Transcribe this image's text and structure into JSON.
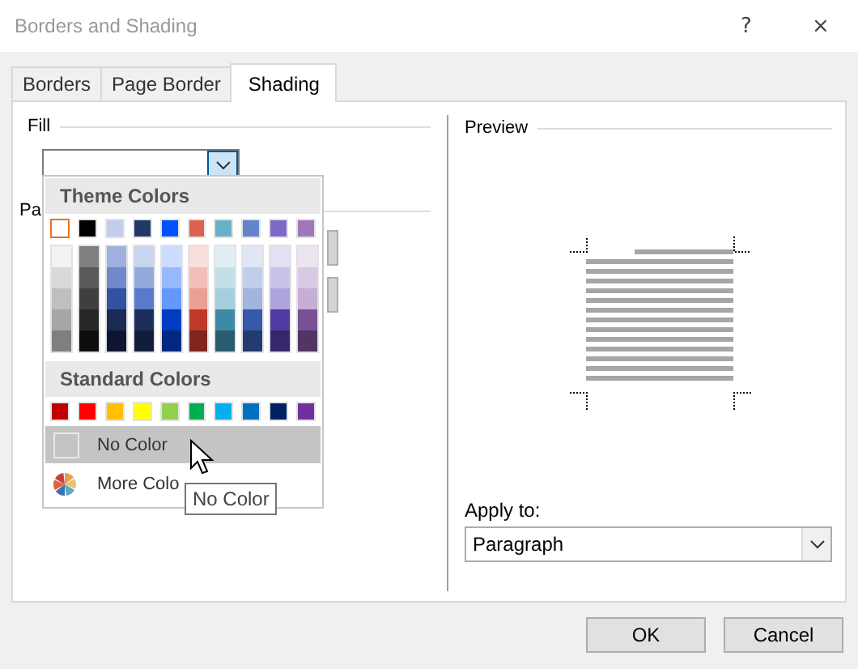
{
  "window": {
    "title": "Borders and Shading",
    "help": "?",
    "close": "×"
  },
  "tabs": [
    {
      "label": "Borders",
      "selected": false
    },
    {
      "label": "Page Border",
      "selected": false
    },
    {
      "label": "Shading",
      "selected": true
    }
  ],
  "fill": {
    "label": "Fill",
    "value_open": true
  },
  "section_2_label": "Pa",
  "color_menu": {
    "theme_header": "Theme Colors",
    "theme_colors": [
      {
        "color": "#ffffff",
        "selected": true,
        "shades": [
          {
            "color": "#f2f2f2"
          },
          {
            "color": "#d9d9d9"
          },
          {
            "color": "#bfbfbf"
          },
          {
            "color": "#a6a6a6"
          },
          {
            "color": "#7f7f7f"
          }
        ]
      },
      {
        "color": "#000000",
        "selected": false,
        "shades": [
          {
            "color": "#7f7f7f"
          },
          {
            "color": "#595959"
          },
          {
            "color": "#3f3f3f"
          },
          {
            "color": "#262626"
          },
          {
            "color": "#0d0d0d"
          }
        ]
      },
      {
        "color": "#c3cdeb",
        "selected": false,
        "shades": [
          {
            "color": "#9fb0de"
          },
          {
            "color": "#7088cc"
          },
          {
            "color": "#3352a0"
          },
          {
            "color": "#1a2a55"
          },
          {
            "color": "#0d1530"
          }
        ]
      },
      {
        "color": "#203864",
        "selected": false,
        "shades": [
          {
            "color": "#c9d4ee"
          },
          {
            "color": "#94aadd"
          },
          {
            "color": "#5b79cc"
          },
          {
            "color": "#1a2f5a"
          },
          {
            "color": "#101e3c"
          }
        ]
      },
      {
        "color": "#0050ff",
        "selected": false,
        "shades": [
          {
            "color": "#ccdcff"
          },
          {
            "color": "#99b9ff"
          },
          {
            "color": "#6697ff"
          },
          {
            "color": "#003cbf"
          },
          {
            "color": "#002880"
          }
        ]
      },
      {
        "color": "#e06050",
        "selected": false,
        "shades": [
          {
            "color": "#f9dfdb"
          },
          {
            "color": "#f2bfb8"
          },
          {
            "color": "#eb9f96"
          },
          {
            "color": "#c03a2a"
          },
          {
            "color": "#80261c"
          }
        ]
      },
      {
        "color": "#6aafc8",
        "selected": false,
        "shades": [
          {
            "color": "#e1eff4"
          },
          {
            "color": "#c3dfe9"
          },
          {
            "color": "#a5cfde"
          },
          {
            "color": "#3e8aa6"
          },
          {
            "color": "#295c6f"
          }
        ]
      },
      {
        "color": "#6384cc",
        "selected": false,
        "shades": [
          {
            "color": "#e0e6f5"
          },
          {
            "color": "#c0cdeb"
          },
          {
            "color": "#a1b5e0"
          },
          {
            "color": "#3659a8"
          },
          {
            "color": "#243b70"
          }
        ]
      },
      {
        "color": "#7b68c8",
        "selected": false,
        "shades": [
          {
            "color": "#e4e0f4"
          },
          {
            "color": "#cac2e9"
          },
          {
            "color": "#afa3de"
          },
          {
            "color": "#4f3aa2"
          },
          {
            "color": "#35276c"
          }
        ]
      },
      {
        "color": "#a078b8",
        "selected": false,
        "shades": [
          {
            "color": "#ece4f1"
          },
          {
            "color": "#d9c9e3"
          },
          {
            "color": "#c6aed4"
          },
          {
            "color": "#7a4f95"
          },
          {
            "color": "#513563"
          }
        ]
      }
    ],
    "standard_header": "Standard Colors",
    "standard_colors": [
      {
        "color": "#c00000"
      },
      {
        "color": "#ff0000"
      },
      {
        "color": "#ffc000"
      },
      {
        "color": "#ffff00"
      },
      {
        "color": "#92d050"
      },
      {
        "color": "#00b050"
      },
      {
        "color": "#00b0f0"
      },
      {
        "color": "#0070c0"
      },
      {
        "color": "#002060"
      },
      {
        "color": "#7030a0"
      }
    ],
    "no_color": {
      "label": "No Color",
      "highlighted": true
    },
    "more_colors": {
      "label": "More Colo"
    }
  },
  "tooltip": "No Color",
  "preview": {
    "label": "Preview"
  },
  "apply_to": {
    "label": "Apply to:",
    "value": "Paragraph"
  },
  "buttons": [
    "OK",
    "Cancel"
  ]
}
